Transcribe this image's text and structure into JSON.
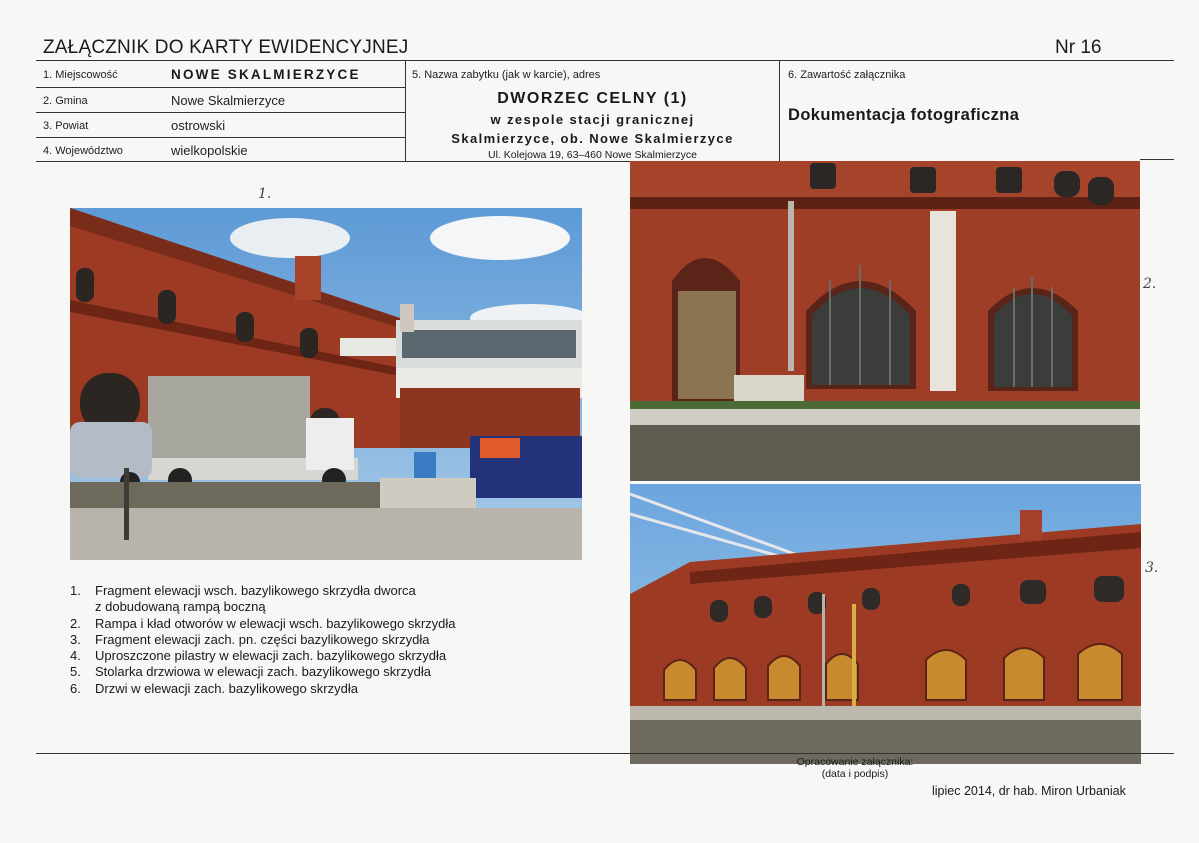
{
  "header": {
    "title": "ZAŁĄCZNIK DO KARTY EWIDENCYJNEJ",
    "nr": "Nr 16"
  },
  "fields": {
    "locality_label": "1. Miejscowość",
    "locality_value": "NOWE SKALMIERZYCE",
    "commune_label": "2. Gmina",
    "commune_value": "Nowe Skalmierzyce",
    "county_label": "3. Powiat",
    "county_value": "ostrowski",
    "voivodeship_label": "4. Województwo",
    "voivodeship_value": "wielkopolskie",
    "monument_label": "5. Nazwa zabytku (jak w karcie), adres",
    "monument_name": "DWORZEC CELNY (1)",
    "monument_sub1": "w zespole stacji granicznej",
    "monument_sub2": "Skalmierzyce, ob. Nowe Skalmierzyce",
    "monument_address": "Ul. Kolejowa 19, 63–460 Nowe Skalmierzyce",
    "content_label": "6. Zawartość załącznika",
    "content_value": "Dokumentacja fotograficzna"
  },
  "photo_numbers": [
    "1.",
    "2.",
    "3."
  ],
  "captions": [
    {
      "n": "1.",
      "text": "Fragment elewacji wsch. bazylikowego skrzydła dworca"
    },
    {
      "n": "",
      "text": "z dobudowaną rampą boczną"
    },
    {
      "n": "2.",
      "text": "Rampa i kład otworów w elewacji wsch. bazylikowego skrzydła"
    },
    {
      "n": "3.",
      "text": "Fragment elewacji zach. pn. części bazylikowego skrzydła"
    },
    {
      "n": "4.",
      "text": "Uproszczone pilastry w elewacji zach. bazylikowego skrzydła"
    },
    {
      "n": "5.",
      "text": "Stolarka drzwiowa w elewacji zach. bazylikowego skrzydła"
    },
    {
      "n": "6.",
      "text": "Drzwi w elewacji zach. bazylikowego skrzydła"
    }
  ],
  "footer": {
    "prepared_label_1": "Opracowanie załącznika:",
    "prepared_label_2": "(data i podpis)",
    "signature": "lipiec 2014, dr hab. Miron Urbaniak"
  },
  "colors": {
    "brick": "#9c3a24",
    "brick_dark": "#6e2516",
    "sky": "#7fb0dc",
    "concrete": "#9a948a"
  }
}
